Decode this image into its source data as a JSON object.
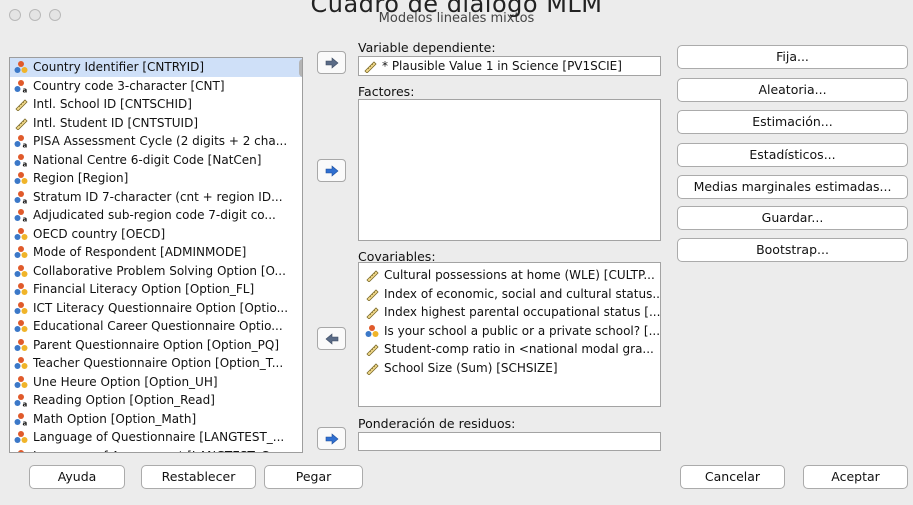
{
  "overlay_title": "Cuadro de diálogo MLM",
  "window": {
    "title": "Modelos lineales mixtos"
  },
  "variables": [
    {
      "label": "Country Identifier [CNTRYID]",
      "icon": "nominal-icon"
    },
    {
      "label": "Country code 3-character [CNT]",
      "icon": "nominal-string-icon"
    },
    {
      "label": "Intl. School ID [CNTSCHID]",
      "icon": "scale-icon"
    },
    {
      "label": "Intl. Student ID [CNTSTUID]",
      "icon": "scale-icon"
    },
    {
      "label": "PISA Assessment Cycle (2 digits + 2 cha...",
      "icon": "nominal-string-icon"
    },
    {
      "label": "National Centre 6-digit Code [NatCen]",
      "icon": "nominal-string-icon"
    },
    {
      "label": "Region [Region]",
      "icon": "nominal-icon"
    },
    {
      "label": "Stratum ID 7-character (cnt + region ID...",
      "icon": "nominal-string-icon"
    },
    {
      "label": "Adjudicated sub-region code 7-digit co...",
      "icon": "nominal-string-icon"
    },
    {
      "label": "OECD country [OECD]",
      "icon": "nominal-icon"
    },
    {
      "label": "Mode of Respondent [ADMINMODE]",
      "icon": "nominal-icon"
    },
    {
      "label": "Collaborative Problem Solving Option [O...",
      "icon": "nominal-icon"
    },
    {
      "label": "Financial Literacy Option [Option_FL]",
      "icon": "nominal-icon"
    },
    {
      "label": "ICT Literacy Questionnaire Option [Optio...",
      "icon": "nominal-icon"
    },
    {
      "label": "Educational Career Questionnaire Optio...",
      "icon": "nominal-icon"
    },
    {
      "label": "Parent Questionnaire Option [Option_PQ]",
      "icon": "nominal-icon"
    },
    {
      "label": "Teacher Questionnaire Option [Option_T...",
      "icon": "nominal-icon"
    },
    {
      "label": "Une Heure Option [Option_UH]",
      "icon": "nominal-icon"
    },
    {
      "label": "Reading Option [Option_Read]",
      "icon": "nominal-string-icon"
    },
    {
      "label": "Math Option [Option_Math]",
      "icon": "nominal-string-icon"
    },
    {
      "label": "Language of Questionnaire [LANGTEST_...",
      "icon": "nominal-icon"
    },
    {
      "label": "Language of Assessment [LANGTEST_C...",
      "icon": "nominal-icon"
    }
  ],
  "dependent": {
    "label": "Variable dependiente:",
    "value": "* Plausible Value 1 in Science [PV1SCIE]",
    "icon": "scale-icon"
  },
  "factors": {
    "label": "Factores:"
  },
  "covariates": {
    "label": "Covariables:",
    "items": [
      {
        "label": "Cultural possessions at home (WLE) [CULTP...",
        "icon": "scale-icon"
      },
      {
        "label": "Index of economic, social and cultural status...",
        "icon": "scale-icon"
      },
      {
        "label": "Index highest parental occupational status [...",
        "icon": "scale-icon"
      },
      {
        "label": "Is your school a public or a private school? [...",
        "icon": "nominal-icon"
      },
      {
        "label": "Student-comp ratio in <national modal gra...",
        "icon": "scale-icon"
      },
      {
        "label": "School Size (Sum) [SCHSIZE]",
        "icon": "scale-icon"
      }
    ]
  },
  "residual_weight": {
    "label": "Ponderación de residuos:"
  },
  "side_buttons": [
    "Fija...",
    "Aleatoria...",
    "Estimación...",
    "Estadísticos...",
    "Medias marginales estimadas...",
    "Guardar...",
    "Bootstrap..."
  ],
  "bottom": {
    "help": "Ayuda",
    "reset": "Restablecer",
    "paste": "Pegar",
    "cancel": "Cancelar",
    "accept": "Aceptar"
  }
}
